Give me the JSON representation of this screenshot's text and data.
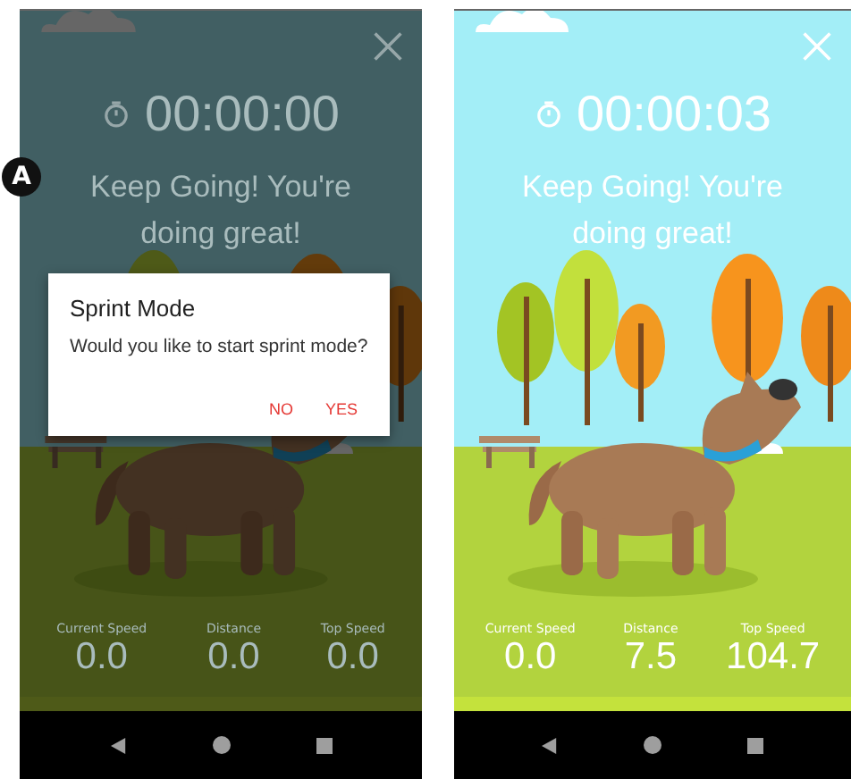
{
  "annotation": {
    "label": "A"
  },
  "screens": [
    {
      "dimmed": true,
      "timer": "00:00:00",
      "message": "Keep Going! You're doing great!",
      "stats": [
        {
          "label": "Current Speed",
          "value": "0.0"
        },
        {
          "label": "Distance",
          "value": "0.0"
        },
        {
          "label": "Top Speed",
          "value": "0.0"
        }
      ],
      "dialog": {
        "title": "Sprint Mode",
        "message": "Would you like to start sprint mode?",
        "buttons": [
          "NO",
          "YES"
        ]
      }
    },
    {
      "dimmed": false,
      "timer": "00:00:03",
      "message": "Keep Going! You're doing great!",
      "stats": [
        {
          "label": "Current Speed",
          "value": "0.0"
        },
        {
          "label": "Distance",
          "value": "7.5"
        },
        {
          "label": "Top Speed",
          "value": "104.7"
        }
      ]
    }
  ]
}
